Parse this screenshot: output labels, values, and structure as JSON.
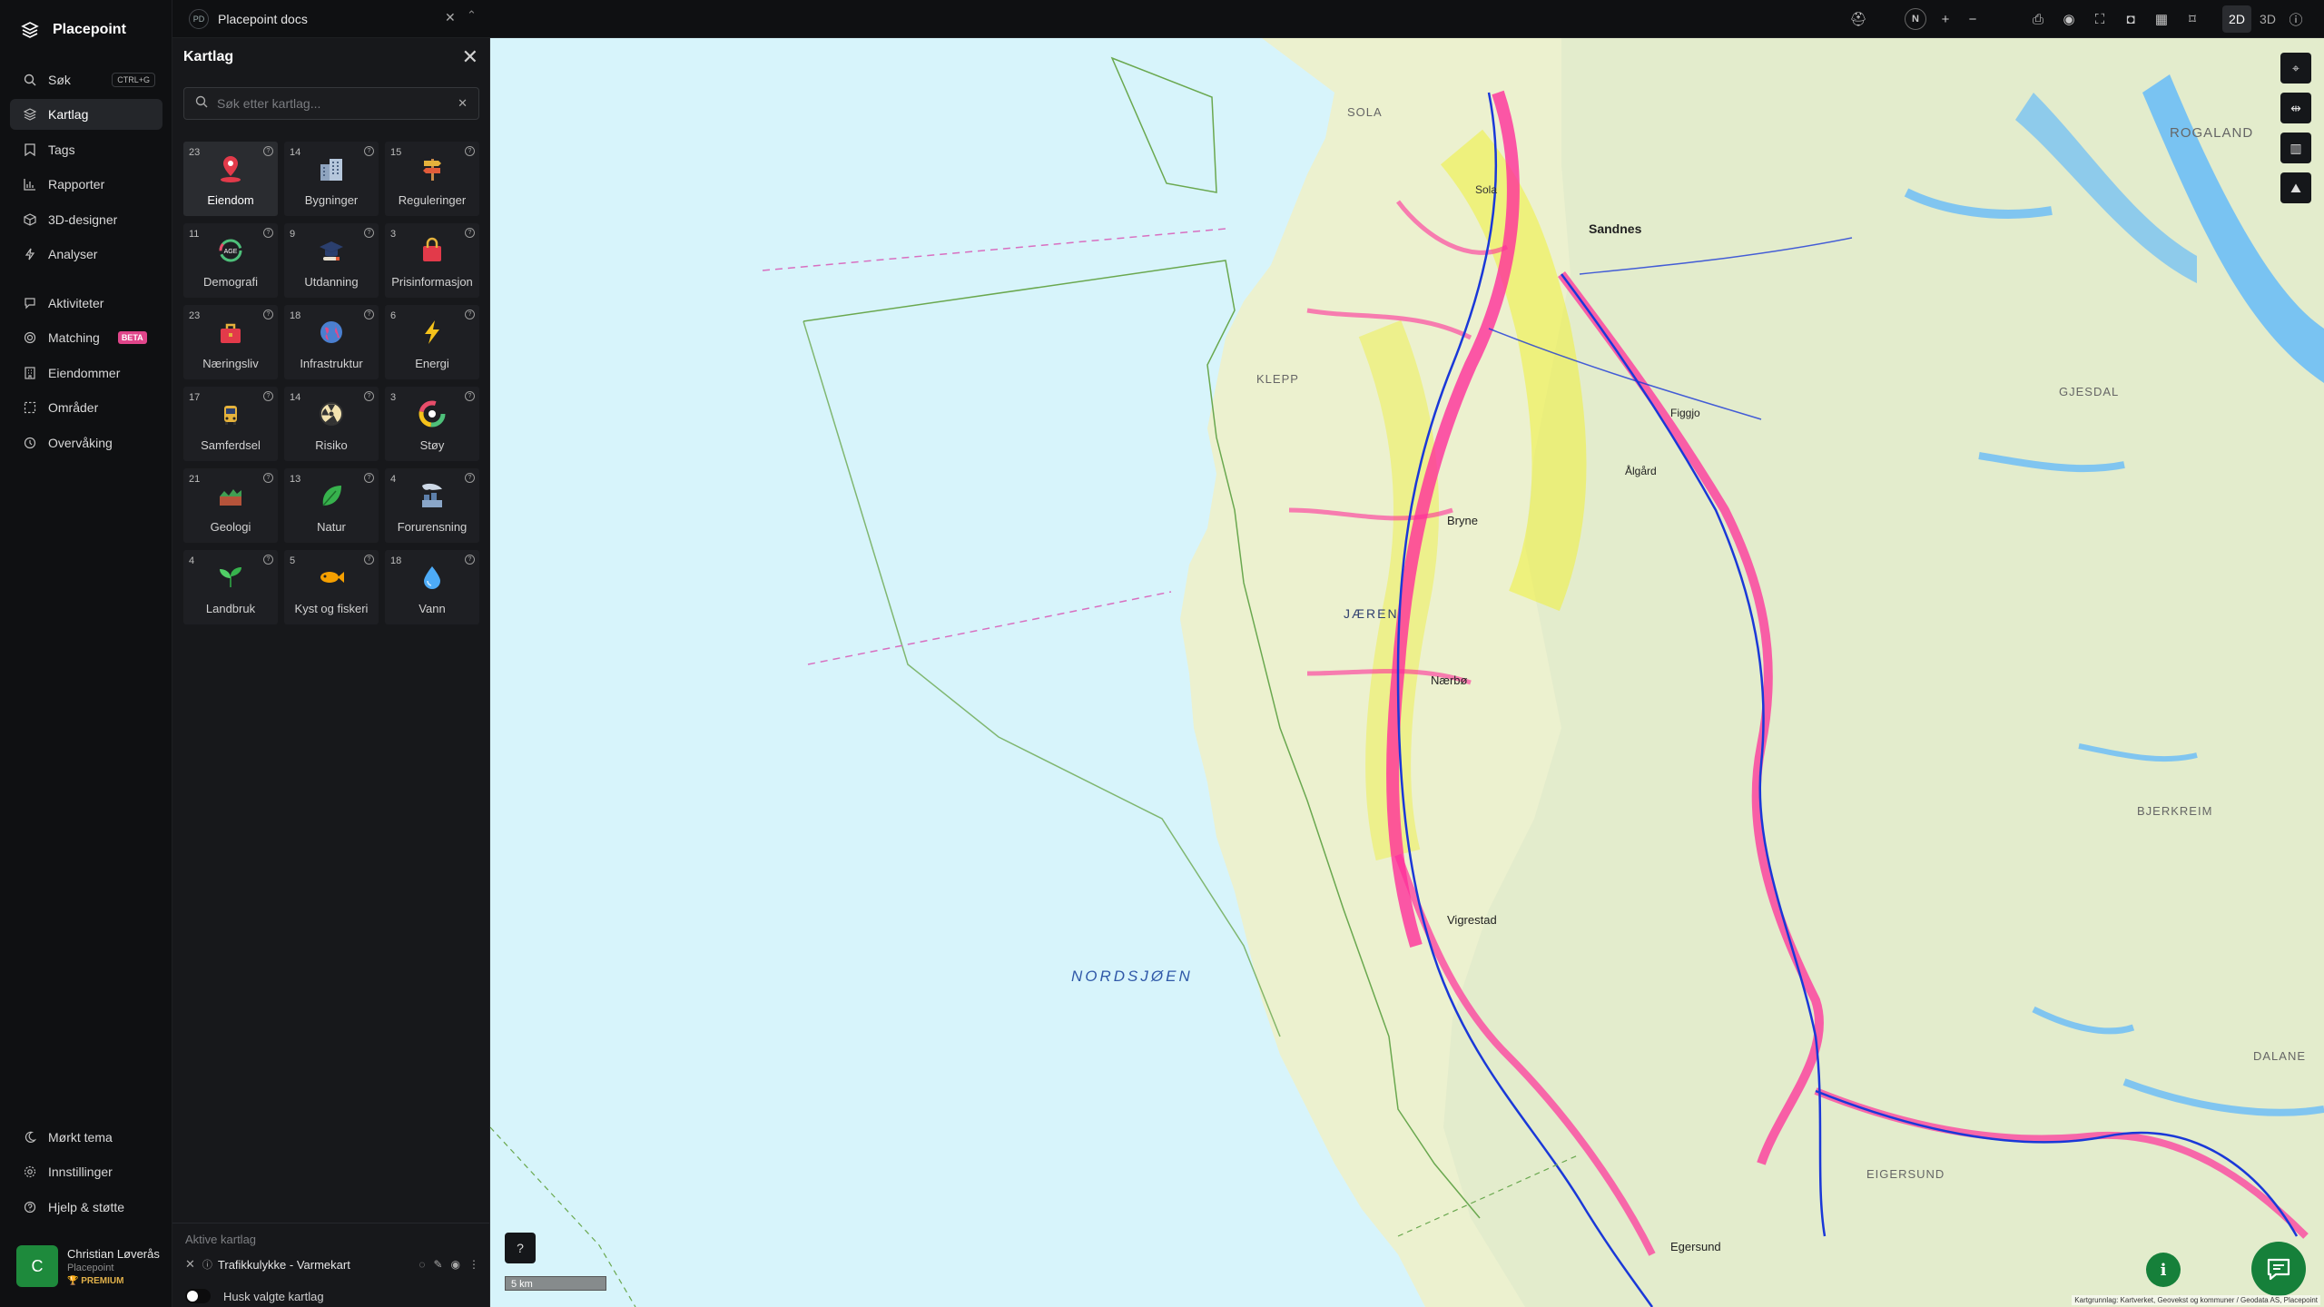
{
  "app": {
    "name": "Placepoint"
  },
  "nav": {
    "items": [
      {
        "label": "Søk",
        "icon": "search-icon",
        "shortcut": "CTRL+G"
      },
      {
        "label": "Kartlag",
        "icon": "layers-icon",
        "active": true
      },
      {
        "label": "Tags",
        "icon": "bookmark-icon"
      },
      {
        "label": "Rapporter",
        "icon": "bar-chart-icon"
      },
      {
        "label": "3D-designer",
        "icon": "cube-icon"
      },
      {
        "label": "Analyser",
        "icon": "bolt-icon"
      },
      {
        "label": "Aktiviteter",
        "icon": "chat-icon"
      },
      {
        "label": "Matching",
        "icon": "target-icon",
        "badge": "BETA"
      },
      {
        "label": "Eiendommer",
        "icon": "building-icon"
      },
      {
        "label": "Områder",
        "icon": "dashed-square-icon"
      },
      {
        "label": "Overvåking",
        "icon": "clock-icon"
      }
    ],
    "bottom": [
      {
        "label": "Mørkt tema",
        "icon": "moon-icon"
      },
      {
        "label": "Innstillinger",
        "icon": "gear-icon"
      },
      {
        "label": "Hjelp & støtte",
        "icon": "help-icon"
      }
    ],
    "user": {
      "initial": "C",
      "name": "Christian Løverås",
      "org": "Placepoint",
      "plan": "PREMIUM"
    }
  },
  "topbar": {
    "doc_badge": "PD",
    "doc_title": "Placepoint docs",
    "north": "N",
    "mode_2d": "2D",
    "mode_3d": "3D"
  },
  "panel": {
    "title": "Kartlag",
    "search_placeholder": "Søk etter kartlag...",
    "tiles": [
      {
        "count": "23",
        "label": "Eiendom",
        "icon": "map-pin-icon",
        "active": true
      },
      {
        "count": "14",
        "label": "Bygninger",
        "icon": "buildings-icon"
      },
      {
        "count": "15",
        "label": "Reguleringer",
        "icon": "signpost-icon"
      },
      {
        "count": "11",
        "label": "Demografi",
        "icon": "age-icon"
      },
      {
        "count": "9",
        "label": "Utdanning",
        "icon": "graduation-cap-icon"
      },
      {
        "count": "3",
        "label": "Prisinformasjon",
        "icon": "shopping-bag-icon"
      },
      {
        "count": "23",
        "label": "Næringsliv",
        "icon": "business-bag-icon"
      },
      {
        "count": "18",
        "label": "Infrastruktur",
        "icon": "globe-icon"
      },
      {
        "count": "6",
        "label": "Energi",
        "icon": "lightning-icon"
      },
      {
        "count": "17",
        "label": "Samferdsel",
        "icon": "bus-icon"
      },
      {
        "count": "14",
        "label": "Risiko",
        "icon": "hazard-icon"
      },
      {
        "count": "3",
        "label": "Støy",
        "icon": "noise-gauge-icon"
      },
      {
        "count": "21",
        "label": "Geologi",
        "icon": "terrain-icon"
      },
      {
        "count": "13",
        "label": "Natur",
        "icon": "leaf-icon"
      },
      {
        "count": "4",
        "label": "Forurensning",
        "icon": "factory-icon"
      },
      {
        "count": "4",
        "label": "Landbruk",
        "icon": "sprout-icon"
      },
      {
        "count": "5",
        "label": "Kyst og fiskeri",
        "icon": "fish-icon"
      },
      {
        "count": "18",
        "label": "Vann",
        "icon": "water-drop-icon"
      }
    ],
    "active_title": "Aktive kartlag",
    "active_layer": "Trafikkulykke - Varmekart",
    "remember_label": "Husk valgte kartlag"
  },
  "map": {
    "labels": {
      "sea": "NORDSJØEN",
      "region1": "ROGALAND",
      "region2": "JÆREN",
      "place_sandnes": "Sandnes",
      "place_sola": "Sola",
      "place_klepp": "KLEPP",
      "place_bryne": "Bryne",
      "place_naerbo": "Nærbø",
      "place_vigrestad": "Vigrestad",
      "place_egersund": "Egersund",
      "place_dalane": "DALANE",
      "place_bjerkreim": "BJERKREIM",
      "place_gjesdal": "GJESDAL",
      "place_sola2": "SOLA",
      "place_algard": "Ålgård",
      "place_figgjo": "Figgjo",
      "place_eigersund": "EIGERSUND"
    },
    "scale_label": "5 km",
    "attribution": "Kartgrunnlag: Kartverket, Geovekst og kommuner / Geodata AS, Placepoint"
  }
}
